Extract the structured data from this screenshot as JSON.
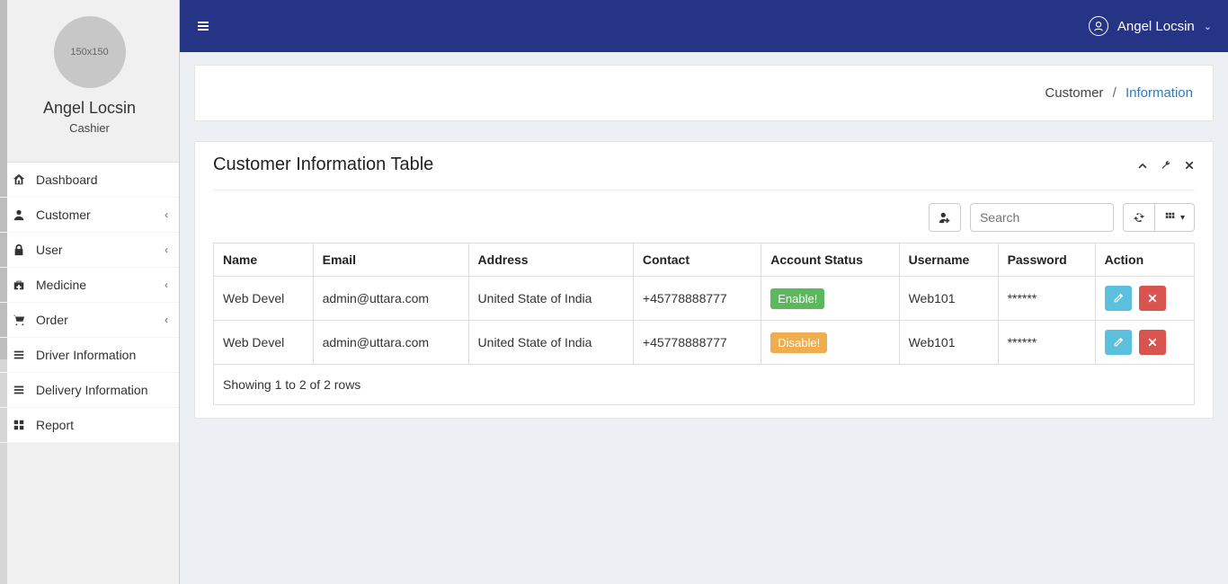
{
  "profile": {
    "avatar_placeholder": "150x150",
    "name": "Angel Locsin",
    "role": "Cashier"
  },
  "header": {
    "user_name": "Angel Locsin"
  },
  "sidebar": {
    "items": [
      {
        "icon": "home-icon",
        "label": "Dashboard",
        "expandable": false
      },
      {
        "icon": "person-icon",
        "label": "Customer",
        "expandable": true
      },
      {
        "icon": "lock-icon",
        "label": "User",
        "expandable": true
      },
      {
        "icon": "medkit-icon",
        "label": "Medicine",
        "expandable": true
      },
      {
        "icon": "cart-icon",
        "label": "Order",
        "expandable": true
      },
      {
        "icon": "list-icon",
        "label": "Driver Information",
        "expandable": false
      },
      {
        "icon": "list-icon",
        "label": "Delivery Information",
        "expandable": false
      },
      {
        "icon": "grid-icon",
        "label": "Report",
        "expandable": false
      }
    ]
  },
  "breadcrumb": {
    "parent": "Customer",
    "current": "Information"
  },
  "panel": {
    "title": "Customer Information Table"
  },
  "toolbar": {
    "search_placeholder": "Search"
  },
  "table": {
    "columns": [
      "Name",
      "Email",
      "Address",
      "Contact",
      "Account Status",
      "Username",
      "Password",
      "Action"
    ],
    "rows": [
      {
        "name": "Web Devel",
        "email": "admin@uttara.com",
        "address": "United State of India",
        "contact": "+45778888777",
        "status_label": "Enable!",
        "status_type": "enable",
        "username": "Web101",
        "password": "******"
      },
      {
        "name": "Web Devel",
        "email": "admin@uttara.com",
        "address": "United State of India",
        "contact": "+45778888777",
        "status_label": "Disable!",
        "status_type": "disable",
        "username": "Web101",
        "password": "******"
      }
    ],
    "footer": "Showing 1 to 2 of 2 rows"
  }
}
